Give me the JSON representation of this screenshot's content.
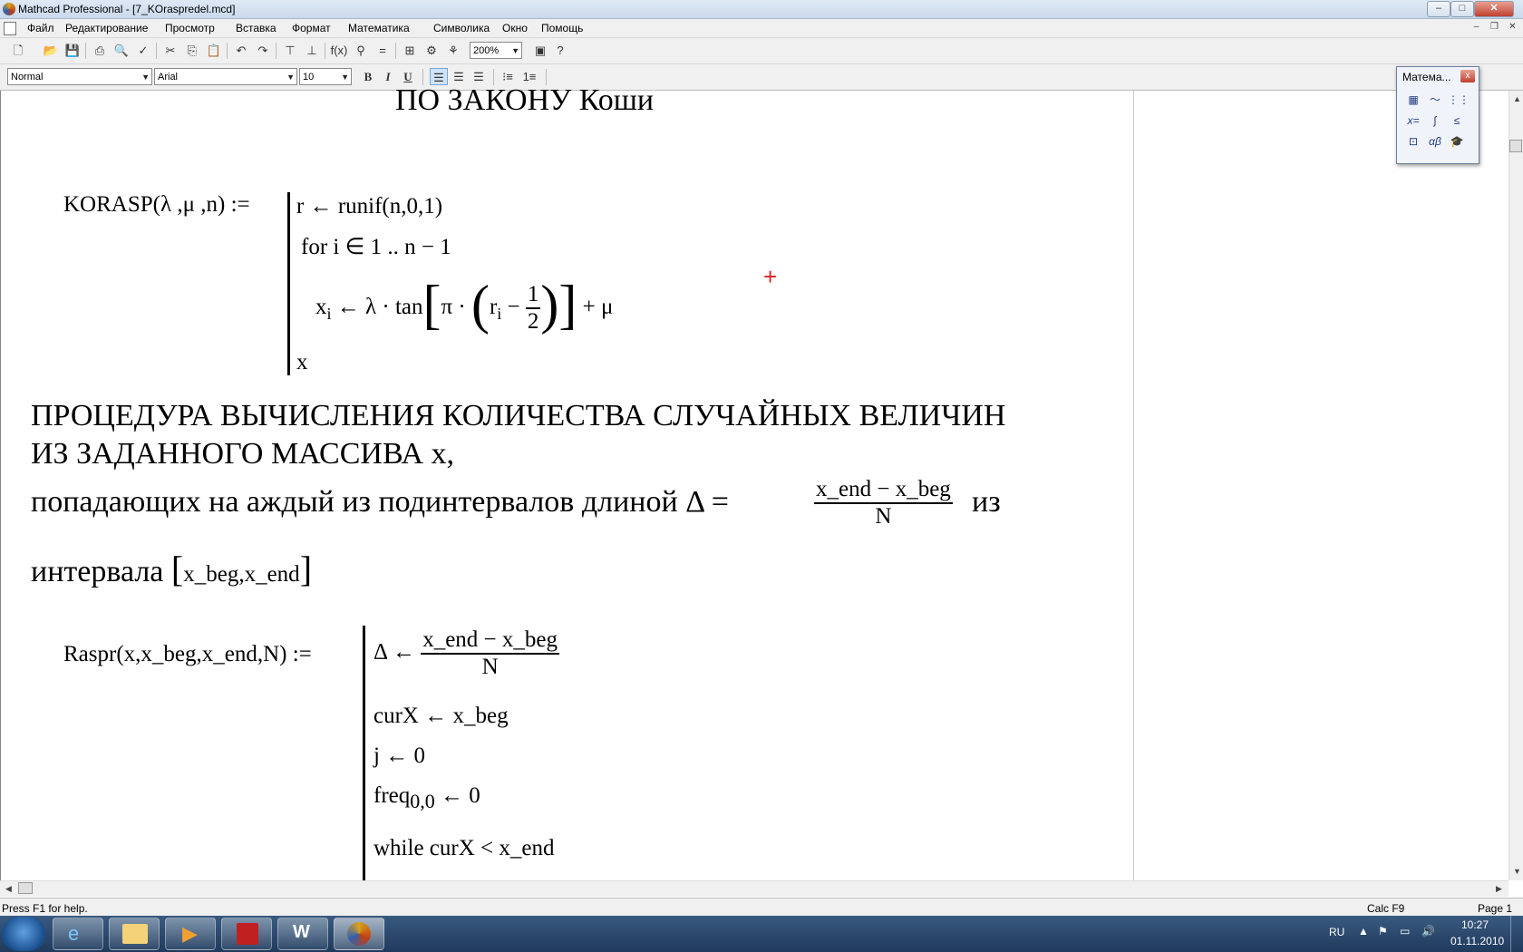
{
  "window": {
    "title": "Mathcad Professional - [7_KOraspredel.mcd]",
    "min": "–",
    "max": "□",
    "close": "✕"
  },
  "menu": [
    "Файл",
    "Редактирование",
    "Просмотр",
    "Вставка",
    "Формат",
    "Математика",
    "Символика",
    "Окно",
    "Помощь"
  ],
  "toolbar": {
    "zoom": "200%"
  },
  "format_bar": {
    "style": "Normal",
    "font": "Arial",
    "size": "10",
    "bold": "B",
    "italic": "I",
    "underline": "U"
  },
  "palette": {
    "title": "Матема...",
    "close": "x"
  },
  "worksheet": {
    "heading_top": "ПО  ЗАКОНУ Коши",
    "korasp": {
      "def": "KORASP(λ ,μ ,n) :=",
      "line1": "r ← runif(n,0,1)",
      "line2": "for  i ∈ 1 .. n − 1",
      "line3_a": "x",
      "line3_sub": "i",
      "line3_b": "← λ · tan",
      "line3_c": "π ·",
      "line3_d": "r",
      "line3_dsub": "i",
      "line3_e": "−",
      "line3_num": "1",
      "line3_den": "2",
      "line3_f": "+ μ",
      "line4": "x"
    },
    "para1": "ПРОЦЕДУРА ВЫЧИСЛЕНИЯ КОЛИЧЕСТВА СЛУЧАЙНЫХ ВЕЛИЧИН",
    "para2": "ИЗ ЗАДАННОГО МАССИВА x,",
    "para3_a": "попадающих на аждый из подинтервалов длиной Δ =",
    "para3_num": "x_end − x_beg",
    "para3_den": "N",
    "para3_b": "из",
    "para4_a": "интервала",
    "para4_b": "x_beg,x_end",
    "raspr": {
      "def": "Raspr(x,x_beg,x_end,N) :=",
      "l1_a": "Δ ←",
      "l1_num": "x_end − x_beg",
      "l1_den": "N",
      "l2": "curX ← x_beg",
      "l3": "j ← 0",
      "l4_a": "freq",
      "l4_sub": "0,0",
      "l4_b": "← 0",
      "l5": "while  curX < x_end"
    }
  },
  "status": {
    "help": "Press F1 for help.",
    "calc": "Calc F9",
    "page": "Page 1"
  },
  "taskbar": {
    "lang": "RU",
    "time": "10:27",
    "date": "01.11.2010"
  }
}
